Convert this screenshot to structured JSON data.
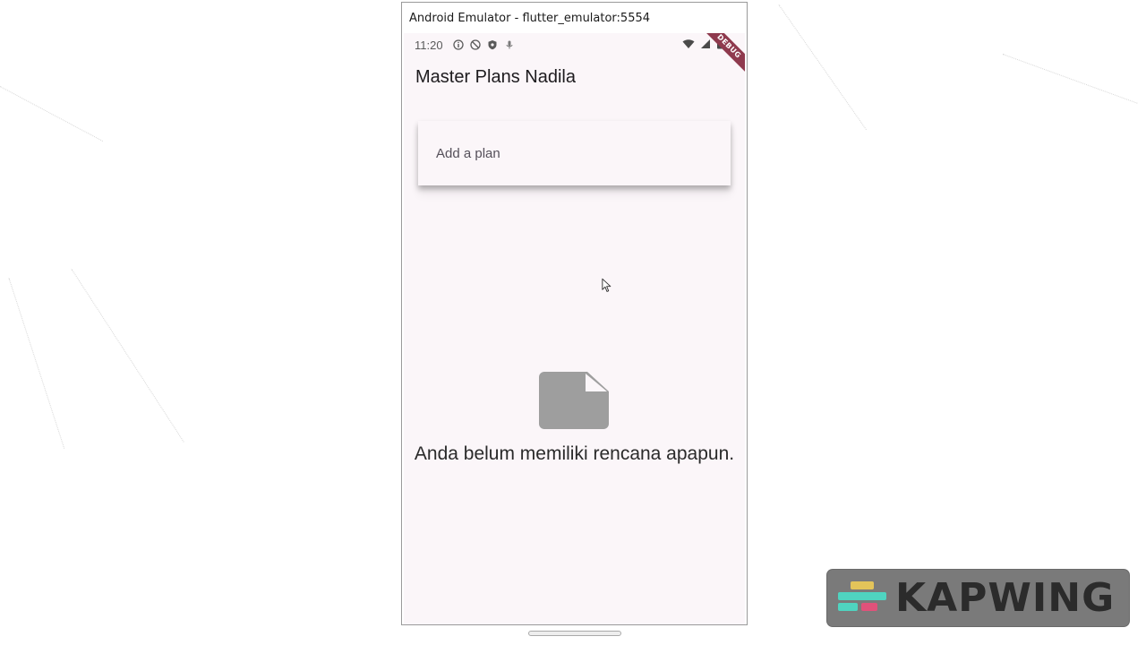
{
  "window": {
    "title": "Android Emulator - flutter_emulator:5554"
  },
  "statusbar": {
    "time": "11:20"
  },
  "debug_banner": "DEBUG",
  "app": {
    "title": "Master Plans Nadila",
    "plan_input_placeholder": "Add a plan",
    "empty_message": "Anda belum memiliki rencana apapun."
  },
  "watermark": {
    "text": "KAPWING"
  },
  "colors": {
    "screen_background": "#fbf6f9",
    "empty_icon": "#9e9e9e",
    "debug_ribbon": "#8f3a4e",
    "watermark_bg": "#7a7a7a"
  }
}
